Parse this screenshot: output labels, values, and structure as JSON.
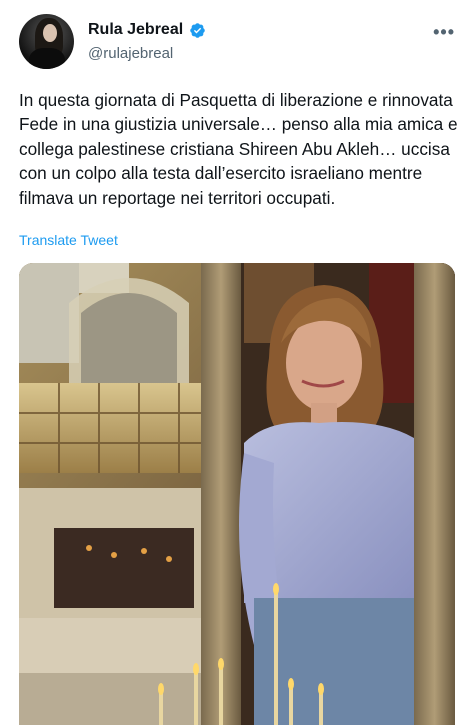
{
  "author": {
    "display_name": "Rula Jebreal",
    "handle": "@rulajebreal",
    "verified": true,
    "avatar_icon": "profile-photo"
  },
  "more_label": "•••",
  "tweet": {
    "text": "In questa giornata di Pasquetta di liberazione e rinnovata Fede in una giustizia universale… penso alla mia amica e collega palestinese cristiana Shireen Abu Akleh… uccisa con un colpo alla testa dall’esercito israeliano mentre filmava un reportage nei territori occupati.",
    "translate_label": "Translate Tweet"
  },
  "colors": {
    "link": "#1d9bf0",
    "verified": "#1d9bf0",
    "secondary_text": "#536471"
  }
}
